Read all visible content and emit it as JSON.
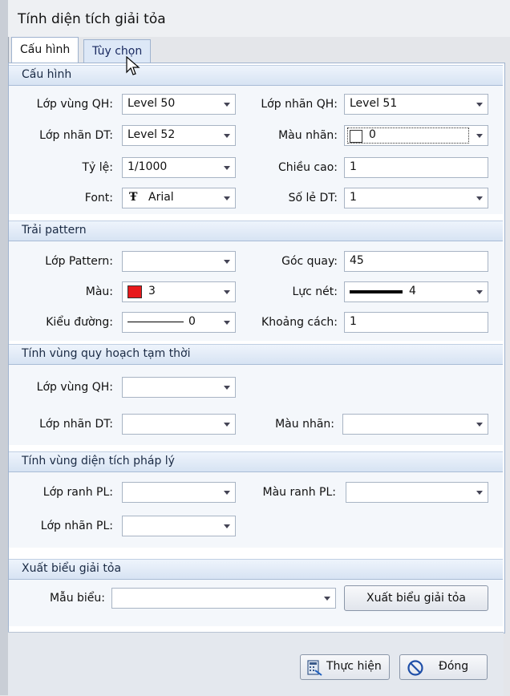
{
  "window": {
    "title": "Tính diện tích giải tỏa"
  },
  "tabs": [
    {
      "label": "Cấu hình"
    },
    {
      "label": "Tùy chọn"
    }
  ],
  "sections": {
    "config": {
      "title": "Cấu hình",
      "lop_vung_qh": {
        "label": "Lớp vùng QH:",
        "value": "Level 50"
      },
      "lop_nhan_qh": {
        "label": "Lớp nhãn QH:",
        "value": "Level 51"
      },
      "lop_nhan_dt": {
        "label": "Lớp nhãn DT:",
        "value": "Level 52"
      },
      "mau_nhan": {
        "label": "Màu nhãn:",
        "value": "0",
        "color": "#ffffff"
      },
      "ty_le": {
        "label": "Tỷ lệ:",
        "value": "1/1000"
      },
      "chieu_cao": {
        "label": "Chiều cao:",
        "value": "1"
      },
      "font": {
        "label": "Font:",
        "value": "Arial",
        "icon": "truetype-font-icon"
      },
      "so_le_dt": {
        "label": "Số lẻ DT:",
        "value": "1"
      }
    },
    "pattern": {
      "title": "Trải pattern",
      "lop_pattern": {
        "label": "Lớp Pattern:",
        "value": ""
      },
      "goc_quay": {
        "label": "Góc quay:",
        "value": "45"
      },
      "mau": {
        "label": "Màu:",
        "value": "3",
        "color": "#e8191b"
      },
      "luc_net": {
        "label": "Lực nét:",
        "value": "4"
      },
      "kieu_duong": {
        "label": "Kiểu đường:",
        "value": "0"
      },
      "khoang_cach": {
        "label": "Khoảng cách:",
        "value": "1"
      }
    },
    "temp_zone": {
      "title": "Tính vùng quy hoạch tạm thời",
      "lop_vung_qh": {
        "label": "Lớp vùng QH:",
        "value": ""
      },
      "lop_nhan_dt": {
        "label": "Lớp nhãn DT:",
        "value": ""
      },
      "mau_nhan": {
        "label": "Màu nhãn:",
        "value": ""
      }
    },
    "legal": {
      "title": "Tính vùng diện tích pháp lý",
      "lop_ranh_pl": {
        "label": "Lớp ranh PL:",
        "value": ""
      },
      "mau_ranh_pl": {
        "label": "Màu ranh PL:",
        "value": ""
      },
      "lop_nhan_pl": {
        "label": "Lớp nhãn PL:",
        "value": ""
      }
    },
    "export": {
      "title": "Xuất biểu giải tỏa",
      "mau_bieu": {
        "label": "Mẫu biểu:",
        "value": ""
      },
      "button": "Xuất biểu giải tỏa"
    }
  },
  "footer": {
    "run": "Thực hiện",
    "close": "Đóng"
  }
}
